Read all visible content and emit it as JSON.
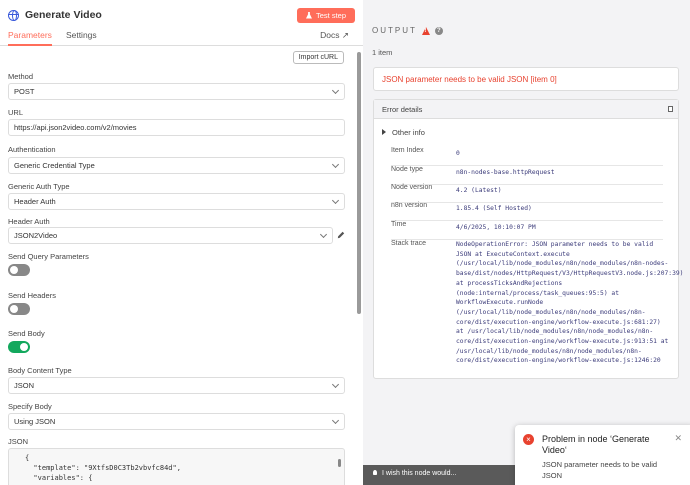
{
  "header": {
    "title": "Generate Video",
    "test_step": "Test step"
  },
  "tabs": {
    "parameters": "Parameters",
    "settings": "Settings",
    "docs": "Docs"
  },
  "params": {
    "import_curl": "Import cURL",
    "method_label": "Method",
    "method_value": "POST",
    "url_label": "URL",
    "url_value": "https://api.json2video.com/v2/movies",
    "auth_label": "Authentication",
    "auth_value": "Generic Credential Type",
    "generic_auth_label": "Generic Auth Type",
    "generic_auth_value": "Header Auth",
    "header_auth_label": "Header Auth",
    "header_auth_value": "JSON2Video",
    "send_query_label": "Send Query Parameters",
    "send_query_on": false,
    "send_headers_label": "Send Headers",
    "send_headers_on": false,
    "send_body_label": "Send Body",
    "send_body_on": true,
    "body_type_label": "Body Content Type",
    "body_type_value": "JSON",
    "specify_body_label": "Specify Body",
    "specify_body_value": "Using JSON",
    "json_label": "JSON",
    "json_line1": "{",
    "json_line2": "  \"template\": \"9XtfsD0C3Tb2vbvfc84d\",",
    "json_line3": "  \"variables\": {"
  },
  "output": {
    "title": "OUTPUT",
    "item_count": "1 item",
    "error_message": "JSON parameter needs to be valid JSON [item 0]",
    "details_title": "Error details",
    "other_info": "Other info",
    "rows": [
      {
        "key": "Item Index",
        "value": "0"
      },
      {
        "key": "Node type",
        "value": "n8n-nodes-base.httpRequest"
      },
      {
        "key": "Node version",
        "value": "4.2 (Latest)"
      },
      {
        "key": "n8n version",
        "value": "1.85.4 (Self Hosted)"
      },
      {
        "key": "Time",
        "value": "4/6/2025, 10:10:07 PM"
      },
      {
        "key": "Stack trace",
        "value": "NodeOperationError: JSON parameter needs to be valid JSON at ExecuteContext.execute (/usr/local/lib/node_modules/n8n/node_modules/n8n-nodes-base/dist/nodes/HttpRequest/V3/HttpRequestV3.node.js:207:39) at processTicksAndRejections (node:internal/process/task_queues:95:5) at WorkflowExecute.runNode (/usr/local/lib/node_modules/n8n/node_modules/n8n-core/dist/execution-engine/workflow-execute.js:681:27) at /usr/local/lib/node_modules/n8n/node_modules/n8n-core/dist/execution-engine/workflow-execute.js:913:51 at /usr/local/lib/node_modules/n8n/node_modules/n8n-core/dist/execution-engine/workflow-execute.js:1246:20"
      }
    ]
  },
  "wish": "I wish this node would...",
  "toast": {
    "title": "Problem in node ‘Generate Video‘",
    "message": "JSON parameter needs to be valid JSON"
  },
  "colors": {
    "accent": "#ff6d5a",
    "error": "#e8422f",
    "toggle_on": "#13a85d"
  }
}
